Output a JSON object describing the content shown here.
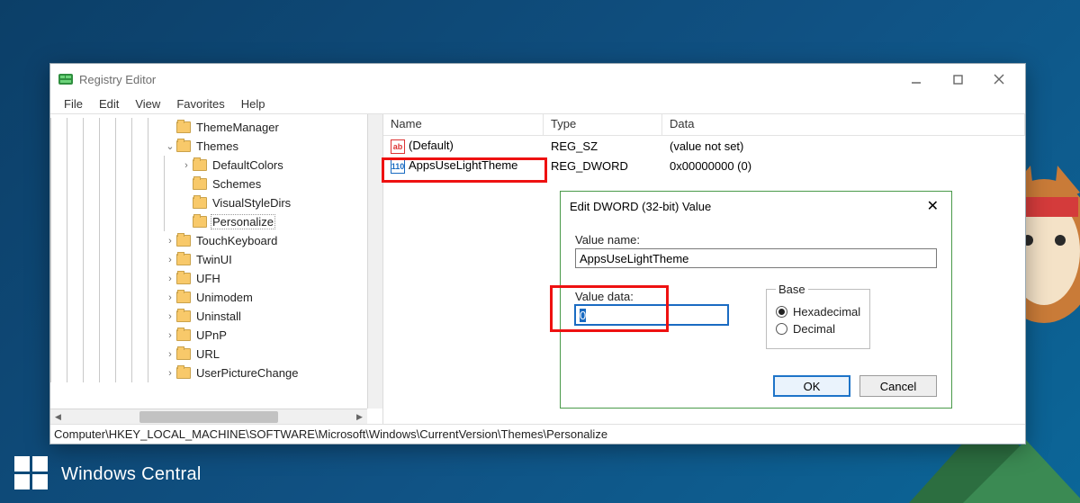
{
  "window": {
    "title": "Registry Editor",
    "menu": [
      "File",
      "Edit",
      "View",
      "Favorites",
      "Help"
    ],
    "statusbar": "Computer\\HKEY_LOCAL_MACHINE\\SOFTWARE\\Microsoft\\Windows\\CurrentVersion\\Themes\\Personalize"
  },
  "tree": [
    {
      "depth": 7,
      "expander": "",
      "label": "ThemeManager"
    },
    {
      "depth": 7,
      "expander": "v",
      "label": "Themes"
    },
    {
      "depth": 8,
      "expander": ">",
      "label": "DefaultColors"
    },
    {
      "depth": 8,
      "expander": "",
      "label": "Schemes"
    },
    {
      "depth": 8,
      "expander": "",
      "label": "VisualStyleDirs"
    },
    {
      "depth": 8,
      "expander": "",
      "label": "Personalize",
      "selected": true
    },
    {
      "depth": 7,
      "expander": ">",
      "label": "TouchKeyboard"
    },
    {
      "depth": 7,
      "expander": ">",
      "label": "TwinUI"
    },
    {
      "depth": 7,
      "expander": ">",
      "label": "UFH"
    },
    {
      "depth": 7,
      "expander": ">",
      "label": "Unimodem"
    },
    {
      "depth": 7,
      "expander": ">",
      "label": "Uninstall"
    },
    {
      "depth": 7,
      "expander": ">",
      "label": "UPnP"
    },
    {
      "depth": 7,
      "expander": ">",
      "label": "URL"
    },
    {
      "depth": 7,
      "expander": ">",
      "label": "UserPictureChange"
    }
  ],
  "list": {
    "columns": {
      "name": "Name",
      "type": "Type",
      "data": "Data"
    },
    "rows": [
      {
        "icon": "sz",
        "name": "(Default)",
        "type": "REG_SZ",
        "data": "(value not set)"
      },
      {
        "icon": "dw",
        "name": "AppsUseLightTheme",
        "type": "REG_DWORD",
        "data": "0x00000000 (0)"
      }
    ]
  },
  "dialog": {
    "title": "Edit DWORD (32-bit) Value",
    "labels": {
      "value_name": "Value name:",
      "value_data": "Value data:",
      "base": "Base"
    },
    "value_name": "AppsUseLightTheme",
    "value_data": "0",
    "base_options": {
      "hex": "Hexadecimal",
      "dec": "Decimal"
    },
    "base_selected": "hex",
    "buttons": {
      "ok": "OK",
      "cancel": "Cancel"
    }
  },
  "brand": "Windows Central"
}
